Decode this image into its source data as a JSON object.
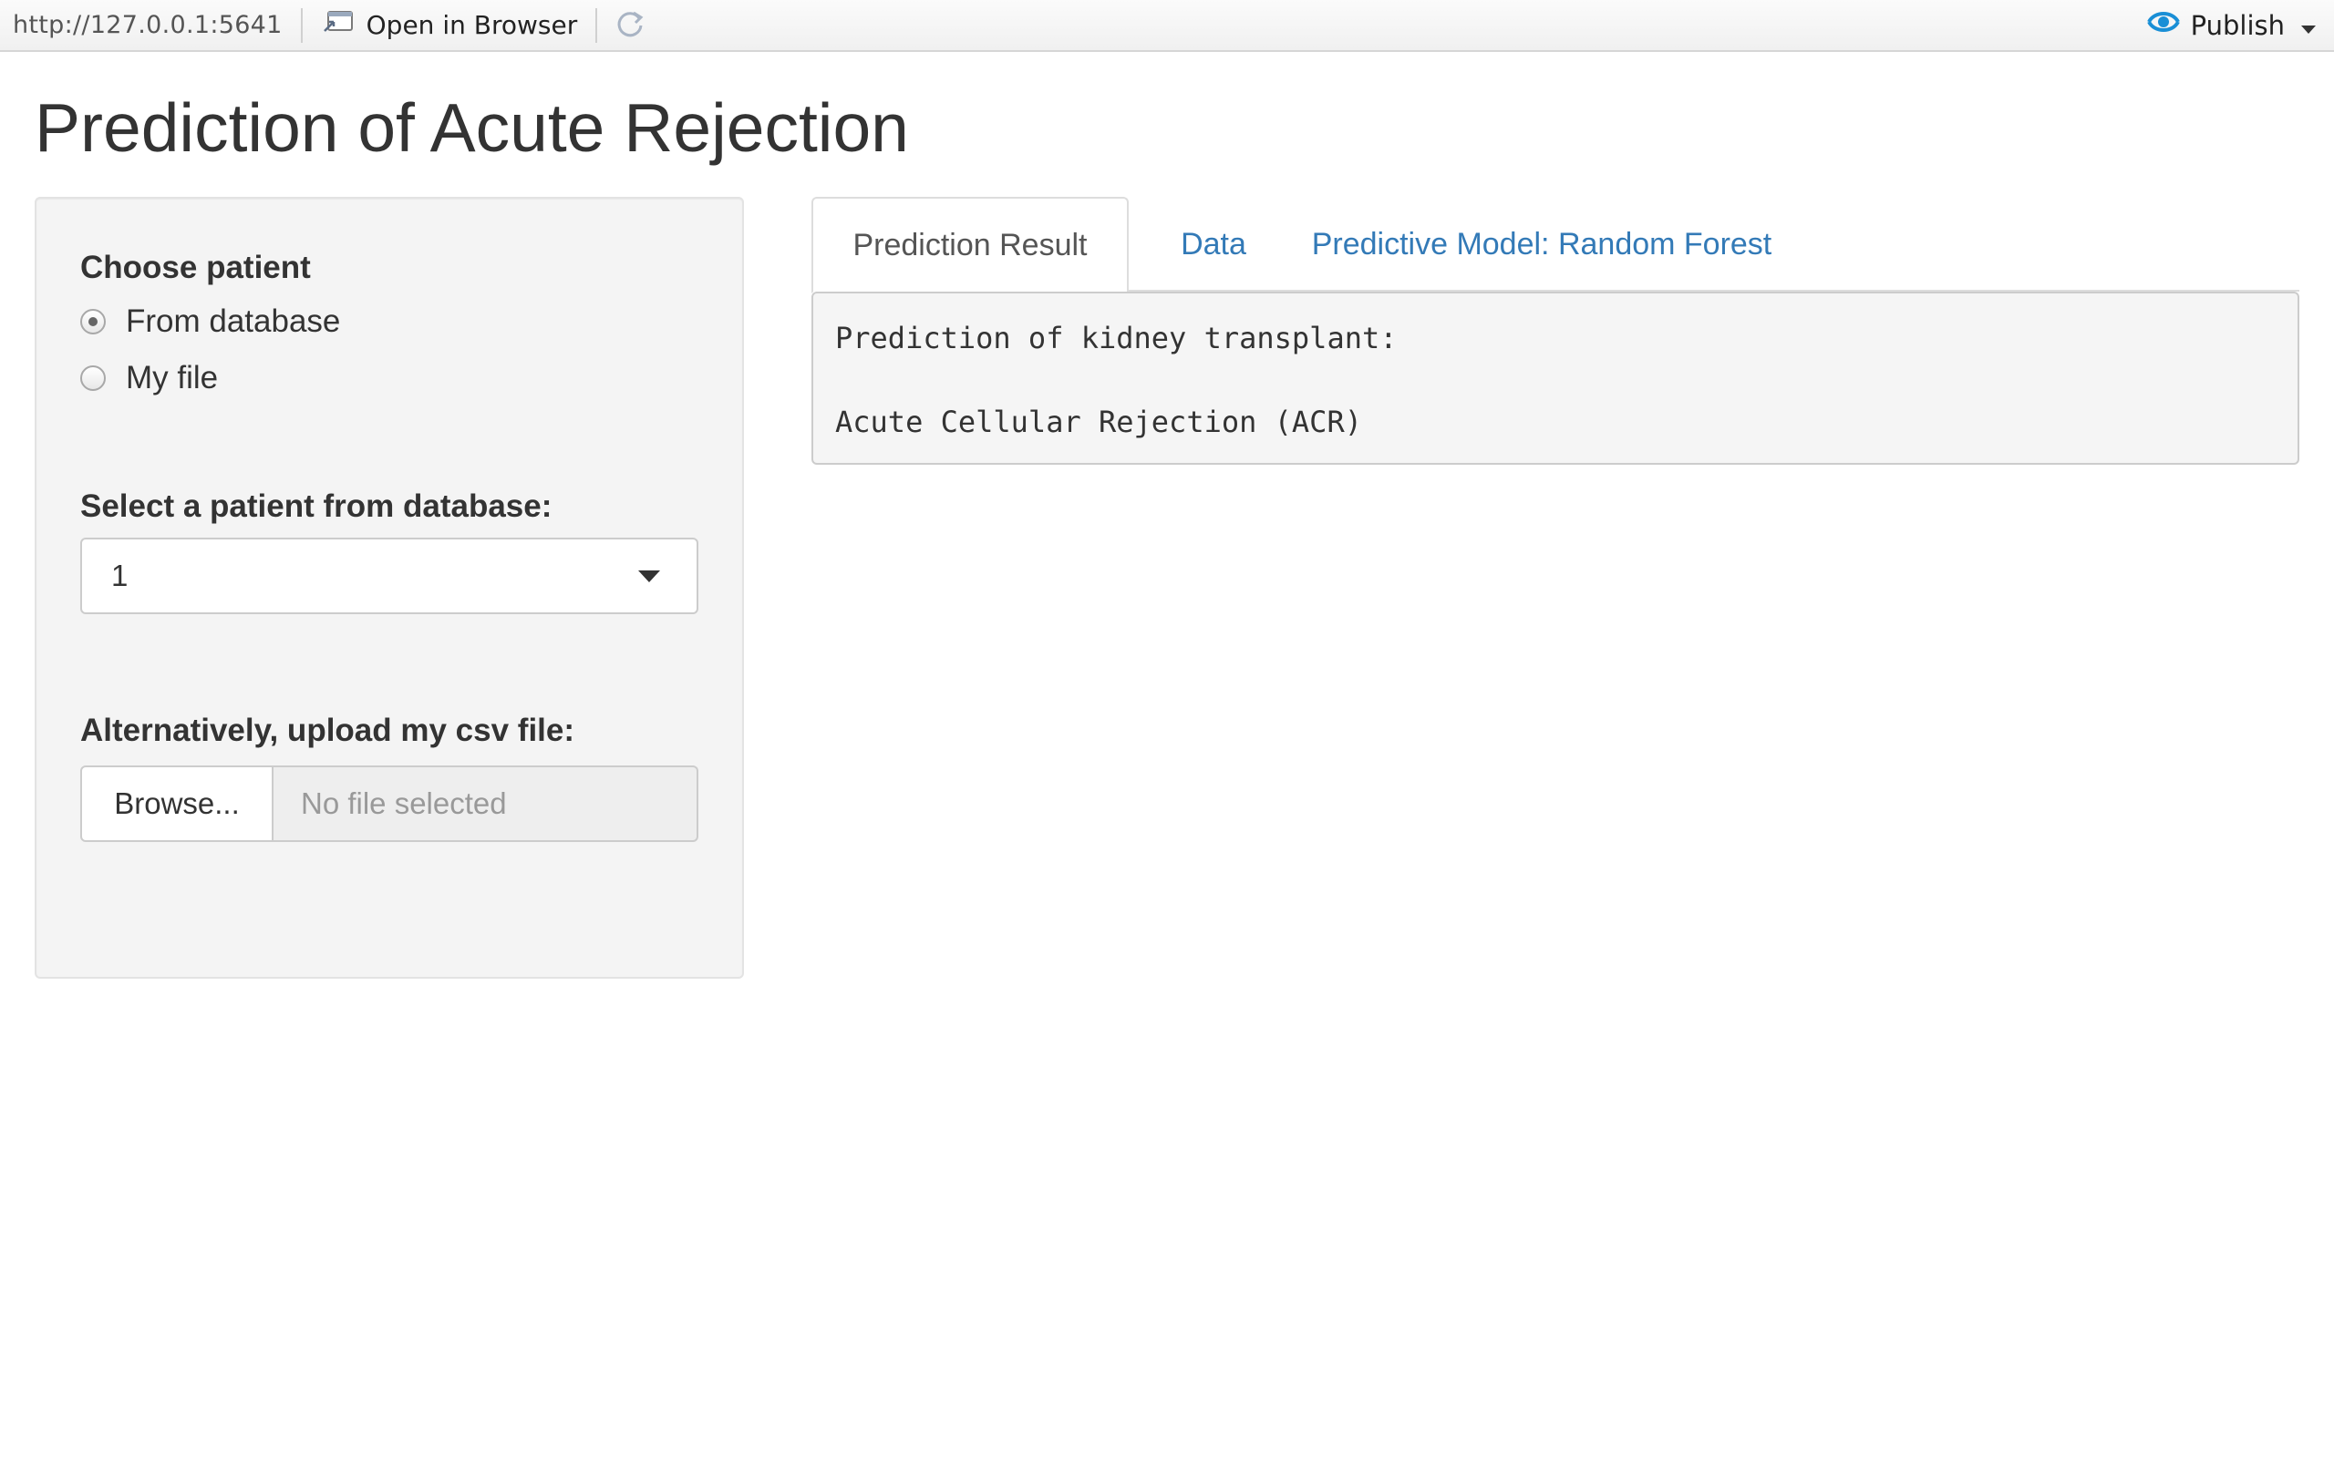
{
  "toolbar": {
    "url": "http://127.0.0.1:5641",
    "open_in_browser": "Open in Browser",
    "publish": "Publish"
  },
  "page": {
    "title": "Prediction of Acute Rejection"
  },
  "sidebar": {
    "choose_patient_label": "Choose patient",
    "radio_options": [
      {
        "label": "From database",
        "checked": true
      },
      {
        "label": "My file",
        "checked": false
      }
    ],
    "select_label": "Select a patient from database:",
    "select_value": "1",
    "upload_label": "Alternatively, upload my csv file:",
    "browse_label": "Browse...",
    "file_placeholder": "No file selected"
  },
  "tabs": [
    {
      "label": "Prediction Result",
      "active": true
    },
    {
      "label": "Data",
      "active": false
    },
    {
      "label": "Predictive Model: Random Forest",
      "active": false
    }
  ],
  "output": {
    "line1": "Prediction of kidney transplant:",
    "line2": "",
    "line3": "Acute Cellular Rejection (ACR)"
  },
  "colors": {
    "link": "#337ab7",
    "publish_icon": "#1a8fd6",
    "well_bg": "#f4f4f4"
  },
  "icons": {
    "open_in_browser": "browser-window-icon",
    "refresh": "refresh-icon",
    "publish": "rstudio-connect-icon",
    "publish_menu": "chevron-down-icon",
    "select_caret": "caret-down-icon"
  }
}
